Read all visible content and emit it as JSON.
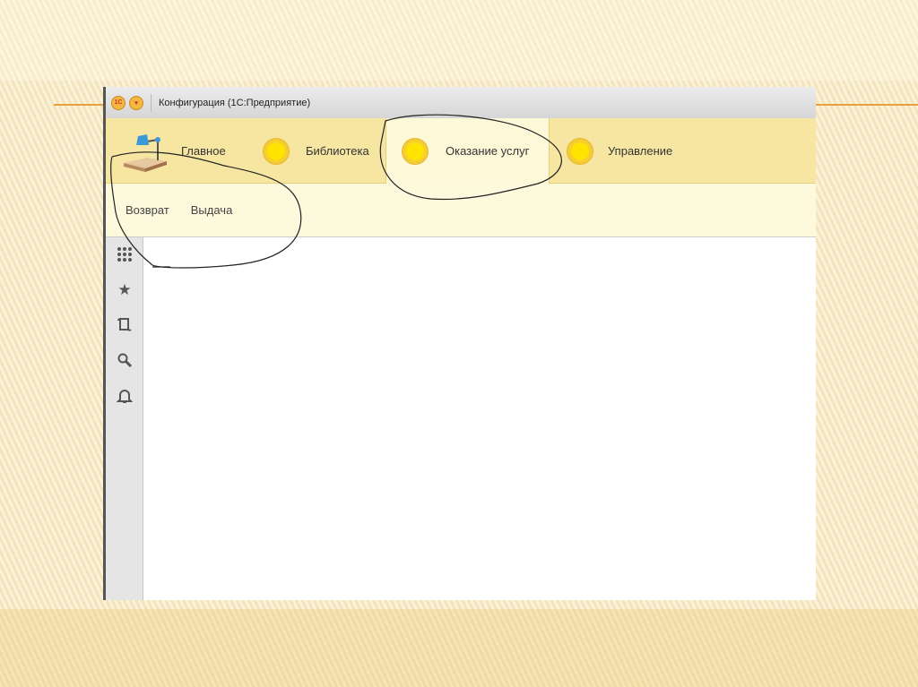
{
  "window": {
    "title": "Конфигурация  (1С:Предприятие)",
    "logo": "1С"
  },
  "sections": [
    {
      "label": "Главное"
    },
    {
      "label": "Библиотека"
    },
    {
      "label": "Оказание услуг"
    },
    {
      "label": "Управление"
    }
  ],
  "subsections": [
    {
      "label": "Возврат"
    },
    {
      "label": "Выдача"
    }
  ],
  "panel_icons": [
    "grid-icon",
    "star-icon",
    "history-icon",
    "search-icon",
    "bell-icon"
  ]
}
